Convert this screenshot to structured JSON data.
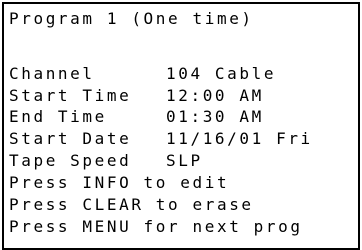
{
  "title": "Program 1 (One time)",
  "fields": [
    {
      "label": "Channel",
      "value": "104 Cable"
    },
    {
      "label": "Start Time",
      "value": "12:00 AM"
    },
    {
      "label": "End Time",
      "value": "01:30 AM"
    },
    {
      "label": "Start Date",
      "value": "11/16/01 Fri"
    },
    {
      "label": "Tape Speed",
      "value": "SLP"
    }
  ],
  "hints": [
    "Press INFO to edit",
    "Press CLEAR to erase",
    "Press MENU for next prog"
  ],
  "colors": {
    "background": "#ffffff",
    "text": "#000000",
    "border": "#000000"
  }
}
